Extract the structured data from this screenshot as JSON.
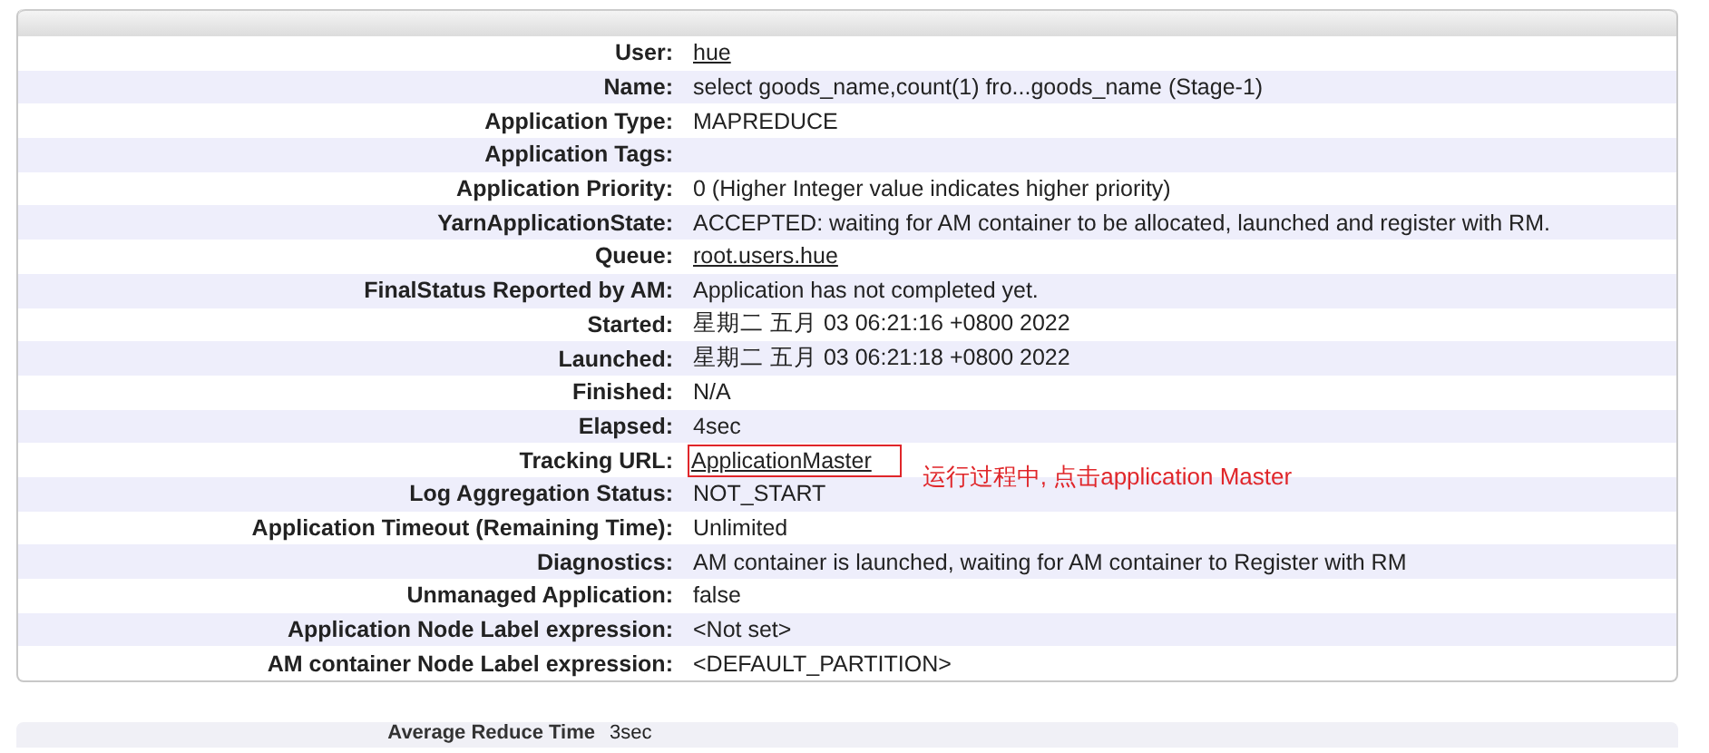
{
  "rows": [
    {
      "label": "User:",
      "value": "hue",
      "kind": "link"
    },
    {
      "label": "Name:",
      "value": "select goods_name,count(1) fro...goods_name (Stage-1)",
      "kind": "text"
    },
    {
      "label": "Application Type:",
      "value": "MAPREDUCE",
      "kind": "text"
    },
    {
      "label": "Application Tags:"
    },
    {
      "label": "Application Priority:",
      "value": "0 (Higher Integer value indicates higher priority)",
      "kind": "text"
    },
    {
      "label": "YarnApplicationState:",
      "value": "ACCEPTED: waiting for AM container to be allocated, launched and register with RM.",
      "kind": "text"
    },
    {
      "label": "Queue:",
      "value": "root.users.hue",
      "kind": "link"
    },
    {
      "label": "FinalStatus Reported by AM:",
      "value": "Application has not completed yet.",
      "kind": "text"
    },
    {
      "label": "Started:",
      "value": "星期二 五月 03 06:21:16 +0800 2022",
      "kind": "text"
    },
    {
      "label": "Launched:",
      "value": "星期二 五月 03 06:21:18 +0800 2022",
      "kind": "text"
    },
    {
      "label": "Finished:",
      "value": "N/A",
      "kind": "text"
    },
    {
      "label": "Elapsed:",
      "value": "4sec",
      "kind": "text"
    },
    {
      "label": "Tracking URL:",
      "value": "ApplicationMaster",
      "kind": "link",
      "highlighted": true,
      "note": "运行过程中, 点击application Master"
    },
    {
      "label": "Log Aggregation Status:",
      "value": "NOT_START",
      "kind": "text"
    },
    {
      "label": "Application Timeout (Remaining Time):",
      "value": "Unlimited",
      "kind": "text"
    },
    {
      "label": "Diagnostics:",
      "value": "AM container is launched, waiting for AM container to Register with RM",
      "kind": "text"
    },
    {
      "label": "Unmanaged Application:",
      "value": "false",
      "kind": "text"
    },
    {
      "label": "Application Node Label expression:",
      "value": "<Not set>",
      "kind": "text"
    },
    {
      "label": "AM container Node Label expression:",
      "value": "<DEFAULT_PARTITION>",
      "kind": "text"
    }
  ],
  "next_row": {
    "label": "Average Reduce Time",
    "value": "3sec"
  }
}
